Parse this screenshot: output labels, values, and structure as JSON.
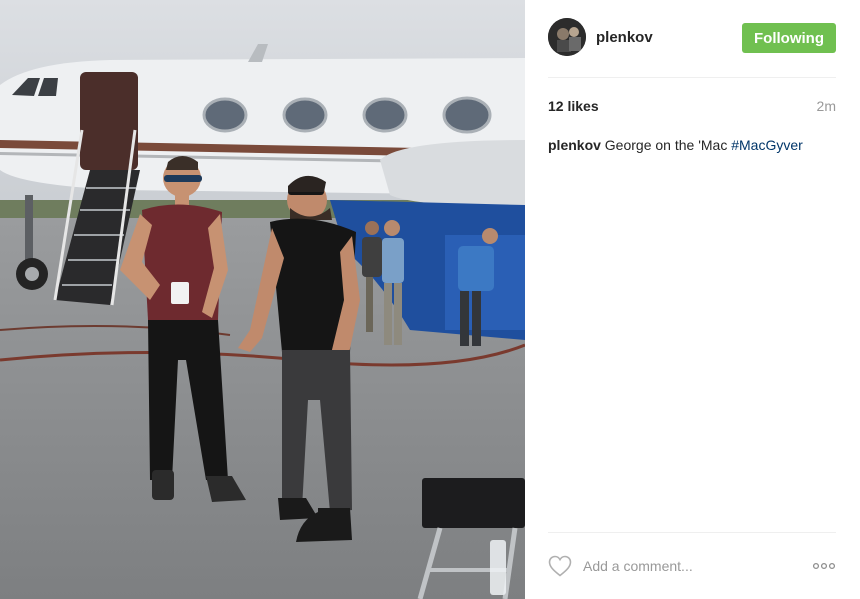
{
  "post": {
    "username": "plenkov",
    "follow_label": "Following",
    "likes": "12 likes",
    "time": "2m",
    "caption": {
      "user": "plenkov",
      "text": "George on the 'Mac",
      "hashtag": "#MacGyver"
    },
    "comment_placeholder": "Add a comment...",
    "icons": {
      "like": "heart-icon",
      "more": "more-options-icon"
    }
  },
  "colors": {
    "follow_button": "#70c050",
    "hashtag": "#003569",
    "muted_text": "#999999"
  }
}
